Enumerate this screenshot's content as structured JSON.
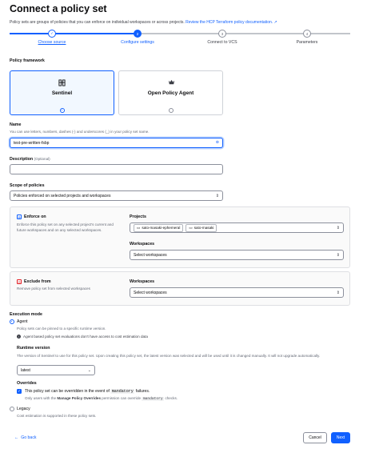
{
  "page": {
    "title": "Connect a policy set",
    "intro_text": "Policy sets are groups of policies that you can enforce on individual workspaces or across projects.",
    "intro_link": "Review the HCP Terraform policy documentation."
  },
  "steps": [
    {
      "number": "✓",
      "label": "Choose source",
      "state": "done"
    },
    {
      "number": "2",
      "label": "Configure settings",
      "state": "current"
    },
    {
      "number": "3",
      "label": "Connect to VCS",
      "state": "todo"
    },
    {
      "number": "4",
      "label": "Parameters",
      "state": "todo"
    }
  ],
  "framework": {
    "label": "Policy framework",
    "options": [
      {
        "name": "Sentinel",
        "selected": true
      },
      {
        "name": "Open Policy Agent",
        "selected": false
      }
    ]
  },
  "name_field": {
    "label": "Name",
    "help": "You can use letters, numbers, dashes (-) and underscores (_) in your policy set name.",
    "value": "test-pre-written-fsbp"
  },
  "description_field": {
    "label": "Description",
    "optional": "(Optional)",
    "value": ""
  },
  "scope": {
    "label": "Scope of policies",
    "selected": "Policies enforced on selected projects and workspaces",
    "enforce_on": {
      "title": "Enforce on",
      "text": "Enforce this policy set on any selected project's current and future workspaces and on any selected workspaces.",
      "projects_label": "Projects",
      "projects": [
        "sato-masaki-ephemeral",
        "sato-masaki"
      ],
      "workspaces_label": "Workspaces",
      "workspaces_placeholder": "Select workspaces"
    },
    "exclude_from": {
      "title": "Exclude from",
      "text": "Remove policy set from selected workspaces",
      "workspaces_label": "Workspaces",
      "workspaces_placeholder": "Select workspaces"
    }
  },
  "execution": {
    "label": "Execution mode",
    "agent": {
      "label": "Agent",
      "help": "Policy sets can be pinned to a specific runtime version.",
      "info": "Agent based policy set evaluations don't have access to cost estimation data"
    },
    "runtime": {
      "label": "Runtime version",
      "help": "The version of Sentinel to use for this policy set. Upon creating this policy set, the latest version was selected and will be used until it is changed manually. It will not upgrade automatically.",
      "value": "latest"
    },
    "overrides": {
      "label": "Overrides",
      "check_prefix": "This policy set can be overridden in the event of",
      "check_code": "mandatory",
      "check_suffix": "failures.",
      "help_prefix": "Only users with the",
      "help_bold": "Manage Policy Overrides",
      "help_mid": "permission can override",
      "help_code": "mandatory",
      "help_suffix": "checks."
    },
    "legacy": {
      "label": "Legacy",
      "help": "Cost estimation is supported in these policy sets."
    }
  },
  "footer": {
    "back": "Go back",
    "cancel": "Cancel",
    "next": "Next"
  },
  "colors": {
    "accent": "#1060ff",
    "text": "#0c0c0e",
    "muted": "#656a76",
    "danger": "#e52228"
  }
}
